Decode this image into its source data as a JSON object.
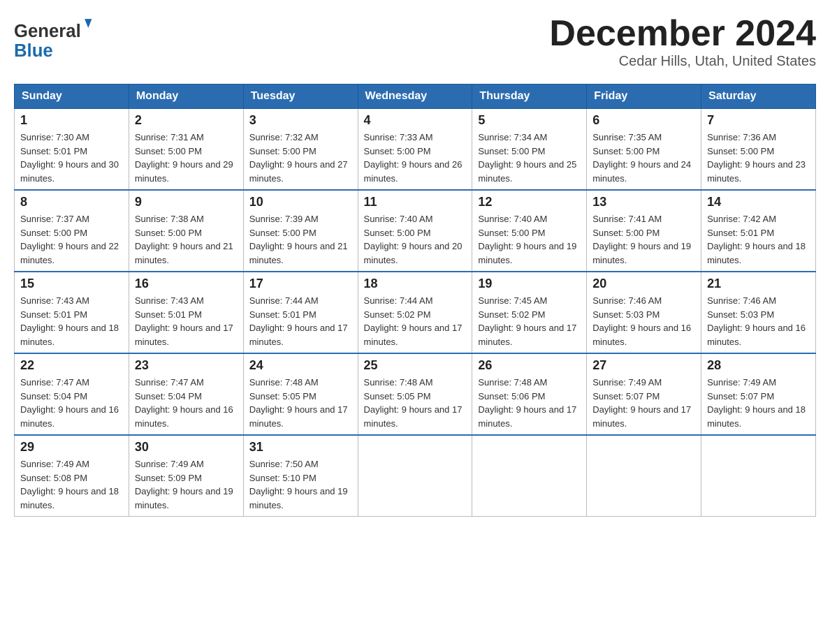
{
  "header": {
    "logo_general": "General",
    "logo_blue": "Blue",
    "month_title": "December 2024",
    "location": "Cedar Hills, Utah, United States"
  },
  "weekdays": [
    "Sunday",
    "Monday",
    "Tuesday",
    "Wednesday",
    "Thursday",
    "Friday",
    "Saturday"
  ],
  "weeks": [
    [
      {
        "day": "1",
        "sunrise": "7:30 AM",
        "sunset": "5:01 PM",
        "daylight": "9 hours and 30 minutes."
      },
      {
        "day": "2",
        "sunrise": "7:31 AM",
        "sunset": "5:00 PM",
        "daylight": "9 hours and 29 minutes."
      },
      {
        "day": "3",
        "sunrise": "7:32 AM",
        "sunset": "5:00 PM",
        "daylight": "9 hours and 27 minutes."
      },
      {
        "day": "4",
        "sunrise": "7:33 AM",
        "sunset": "5:00 PM",
        "daylight": "9 hours and 26 minutes."
      },
      {
        "day": "5",
        "sunrise": "7:34 AM",
        "sunset": "5:00 PM",
        "daylight": "9 hours and 25 minutes."
      },
      {
        "day": "6",
        "sunrise": "7:35 AM",
        "sunset": "5:00 PM",
        "daylight": "9 hours and 24 minutes."
      },
      {
        "day": "7",
        "sunrise": "7:36 AM",
        "sunset": "5:00 PM",
        "daylight": "9 hours and 23 minutes."
      }
    ],
    [
      {
        "day": "8",
        "sunrise": "7:37 AM",
        "sunset": "5:00 PM",
        "daylight": "9 hours and 22 minutes."
      },
      {
        "day": "9",
        "sunrise": "7:38 AM",
        "sunset": "5:00 PM",
        "daylight": "9 hours and 21 minutes."
      },
      {
        "day": "10",
        "sunrise": "7:39 AM",
        "sunset": "5:00 PM",
        "daylight": "9 hours and 21 minutes."
      },
      {
        "day": "11",
        "sunrise": "7:40 AM",
        "sunset": "5:00 PM",
        "daylight": "9 hours and 20 minutes."
      },
      {
        "day": "12",
        "sunrise": "7:40 AM",
        "sunset": "5:00 PM",
        "daylight": "9 hours and 19 minutes."
      },
      {
        "day": "13",
        "sunrise": "7:41 AM",
        "sunset": "5:00 PM",
        "daylight": "9 hours and 19 minutes."
      },
      {
        "day": "14",
        "sunrise": "7:42 AM",
        "sunset": "5:01 PM",
        "daylight": "9 hours and 18 minutes."
      }
    ],
    [
      {
        "day": "15",
        "sunrise": "7:43 AM",
        "sunset": "5:01 PM",
        "daylight": "9 hours and 18 minutes."
      },
      {
        "day": "16",
        "sunrise": "7:43 AM",
        "sunset": "5:01 PM",
        "daylight": "9 hours and 17 minutes."
      },
      {
        "day": "17",
        "sunrise": "7:44 AM",
        "sunset": "5:01 PM",
        "daylight": "9 hours and 17 minutes."
      },
      {
        "day": "18",
        "sunrise": "7:44 AM",
        "sunset": "5:02 PM",
        "daylight": "9 hours and 17 minutes."
      },
      {
        "day": "19",
        "sunrise": "7:45 AM",
        "sunset": "5:02 PM",
        "daylight": "9 hours and 17 minutes."
      },
      {
        "day": "20",
        "sunrise": "7:46 AM",
        "sunset": "5:03 PM",
        "daylight": "9 hours and 16 minutes."
      },
      {
        "day": "21",
        "sunrise": "7:46 AM",
        "sunset": "5:03 PM",
        "daylight": "9 hours and 16 minutes."
      }
    ],
    [
      {
        "day": "22",
        "sunrise": "7:47 AM",
        "sunset": "5:04 PM",
        "daylight": "9 hours and 16 minutes."
      },
      {
        "day": "23",
        "sunrise": "7:47 AM",
        "sunset": "5:04 PM",
        "daylight": "9 hours and 16 minutes."
      },
      {
        "day": "24",
        "sunrise": "7:48 AM",
        "sunset": "5:05 PM",
        "daylight": "9 hours and 17 minutes."
      },
      {
        "day": "25",
        "sunrise": "7:48 AM",
        "sunset": "5:05 PM",
        "daylight": "9 hours and 17 minutes."
      },
      {
        "day": "26",
        "sunrise": "7:48 AM",
        "sunset": "5:06 PM",
        "daylight": "9 hours and 17 minutes."
      },
      {
        "day": "27",
        "sunrise": "7:49 AM",
        "sunset": "5:07 PM",
        "daylight": "9 hours and 17 minutes."
      },
      {
        "day": "28",
        "sunrise": "7:49 AM",
        "sunset": "5:07 PM",
        "daylight": "9 hours and 18 minutes."
      }
    ],
    [
      {
        "day": "29",
        "sunrise": "7:49 AM",
        "sunset": "5:08 PM",
        "daylight": "9 hours and 18 minutes."
      },
      {
        "day": "30",
        "sunrise": "7:49 AM",
        "sunset": "5:09 PM",
        "daylight": "9 hours and 19 minutes."
      },
      {
        "day": "31",
        "sunrise": "7:50 AM",
        "sunset": "5:10 PM",
        "daylight": "9 hours and 19 minutes."
      },
      null,
      null,
      null,
      null
    ]
  ]
}
